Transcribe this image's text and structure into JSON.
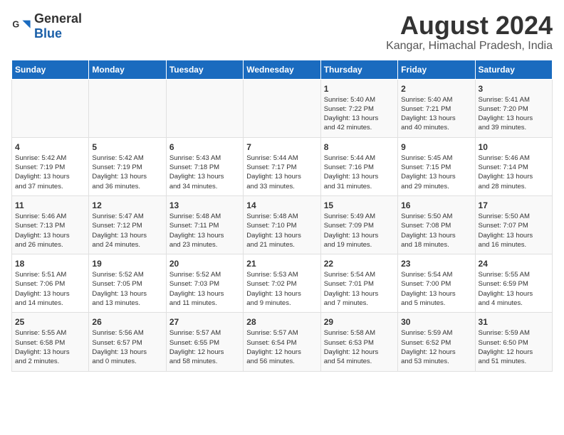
{
  "header": {
    "logo_general": "General",
    "logo_blue": "Blue",
    "month_year": "August 2024",
    "location": "Kangar, Himachal Pradesh, India"
  },
  "weekdays": [
    "Sunday",
    "Monday",
    "Tuesday",
    "Wednesday",
    "Thursday",
    "Friday",
    "Saturday"
  ],
  "weeks": [
    [
      {
        "day": "",
        "content": ""
      },
      {
        "day": "",
        "content": ""
      },
      {
        "day": "",
        "content": ""
      },
      {
        "day": "",
        "content": ""
      },
      {
        "day": "1",
        "content": "Sunrise: 5:40 AM\nSunset: 7:22 PM\nDaylight: 13 hours\nand 42 minutes."
      },
      {
        "day": "2",
        "content": "Sunrise: 5:40 AM\nSunset: 7:21 PM\nDaylight: 13 hours\nand 40 minutes."
      },
      {
        "day": "3",
        "content": "Sunrise: 5:41 AM\nSunset: 7:20 PM\nDaylight: 13 hours\nand 39 minutes."
      }
    ],
    [
      {
        "day": "4",
        "content": "Sunrise: 5:42 AM\nSunset: 7:19 PM\nDaylight: 13 hours\nand 37 minutes."
      },
      {
        "day": "5",
        "content": "Sunrise: 5:42 AM\nSunset: 7:19 PM\nDaylight: 13 hours\nand 36 minutes."
      },
      {
        "day": "6",
        "content": "Sunrise: 5:43 AM\nSunset: 7:18 PM\nDaylight: 13 hours\nand 34 minutes."
      },
      {
        "day": "7",
        "content": "Sunrise: 5:44 AM\nSunset: 7:17 PM\nDaylight: 13 hours\nand 33 minutes."
      },
      {
        "day": "8",
        "content": "Sunrise: 5:44 AM\nSunset: 7:16 PM\nDaylight: 13 hours\nand 31 minutes."
      },
      {
        "day": "9",
        "content": "Sunrise: 5:45 AM\nSunset: 7:15 PM\nDaylight: 13 hours\nand 29 minutes."
      },
      {
        "day": "10",
        "content": "Sunrise: 5:46 AM\nSunset: 7:14 PM\nDaylight: 13 hours\nand 28 minutes."
      }
    ],
    [
      {
        "day": "11",
        "content": "Sunrise: 5:46 AM\nSunset: 7:13 PM\nDaylight: 13 hours\nand 26 minutes."
      },
      {
        "day": "12",
        "content": "Sunrise: 5:47 AM\nSunset: 7:12 PM\nDaylight: 13 hours\nand 24 minutes."
      },
      {
        "day": "13",
        "content": "Sunrise: 5:48 AM\nSunset: 7:11 PM\nDaylight: 13 hours\nand 23 minutes."
      },
      {
        "day": "14",
        "content": "Sunrise: 5:48 AM\nSunset: 7:10 PM\nDaylight: 13 hours\nand 21 minutes."
      },
      {
        "day": "15",
        "content": "Sunrise: 5:49 AM\nSunset: 7:09 PM\nDaylight: 13 hours\nand 19 minutes."
      },
      {
        "day": "16",
        "content": "Sunrise: 5:50 AM\nSunset: 7:08 PM\nDaylight: 13 hours\nand 18 minutes."
      },
      {
        "day": "17",
        "content": "Sunrise: 5:50 AM\nSunset: 7:07 PM\nDaylight: 13 hours\nand 16 minutes."
      }
    ],
    [
      {
        "day": "18",
        "content": "Sunrise: 5:51 AM\nSunset: 7:06 PM\nDaylight: 13 hours\nand 14 minutes."
      },
      {
        "day": "19",
        "content": "Sunrise: 5:52 AM\nSunset: 7:05 PM\nDaylight: 13 hours\nand 13 minutes."
      },
      {
        "day": "20",
        "content": "Sunrise: 5:52 AM\nSunset: 7:03 PM\nDaylight: 13 hours\nand 11 minutes."
      },
      {
        "day": "21",
        "content": "Sunrise: 5:53 AM\nSunset: 7:02 PM\nDaylight: 13 hours\nand 9 minutes."
      },
      {
        "day": "22",
        "content": "Sunrise: 5:54 AM\nSunset: 7:01 PM\nDaylight: 13 hours\nand 7 minutes."
      },
      {
        "day": "23",
        "content": "Sunrise: 5:54 AM\nSunset: 7:00 PM\nDaylight: 13 hours\nand 5 minutes."
      },
      {
        "day": "24",
        "content": "Sunrise: 5:55 AM\nSunset: 6:59 PM\nDaylight: 13 hours\nand 4 minutes."
      }
    ],
    [
      {
        "day": "25",
        "content": "Sunrise: 5:55 AM\nSunset: 6:58 PM\nDaylight: 13 hours\nand 2 minutes."
      },
      {
        "day": "26",
        "content": "Sunrise: 5:56 AM\nSunset: 6:57 PM\nDaylight: 13 hours\nand 0 minutes."
      },
      {
        "day": "27",
        "content": "Sunrise: 5:57 AM\nSunset: 6:55 PM\nDaylight: 12 hours\nand 58 minutes."
      },
      {
        "day": "28",
        "content": "Sunrise: 5:57 AM\nSunset: 6:54 PM\nDaylight: 12 hours\nand 56 minutes."
      },
      {
        "day": "29",
        "content": "Sunrise: 5:58 AM\nSunset: 6:53 PM\nDaylight: 12 hours\nand 54 minutes."
      },
      {
        "day": "30",
        "content": "Sunrise: 5:59 AM\nSunset: 6:52 PM\nDaylight: 12 hours\nand 53 minutes."
      },
      {
        "day": "31",
        "content": "Sunrise: 5:59 AM\nSunset: 6:50 PM\nDaylight: 12 hours\nand 51 minutes."
      }
    ]
  ]
}
